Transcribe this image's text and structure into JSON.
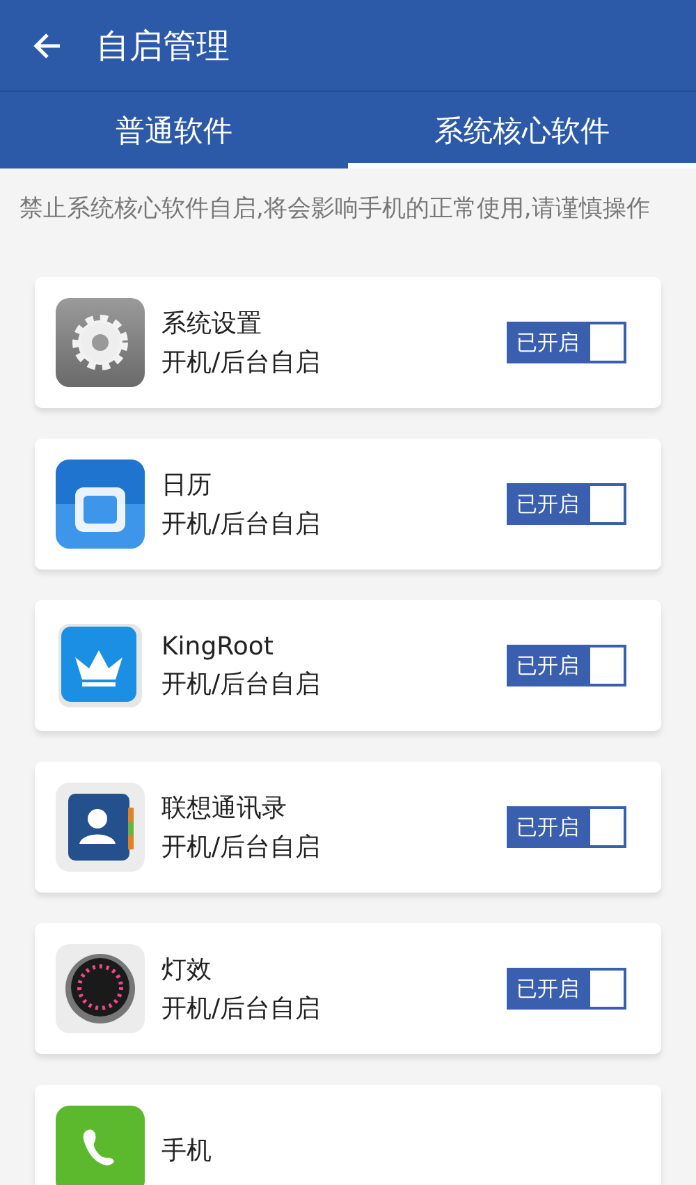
{
  "header": {
    "title": "自启管理"
  },
  "tabs": [
    {
      "label": "普通软件",
      "selected": false
    },
    {
      "label": "系统核心软件",
      "selected": true
    }
  ],
  "notice": "禁止系统核心软件自启,将会影响手机的正常使用,请谨慎操作",
  "apps": [
    {
      "kind": "settings",
      "name": "系统设置",
      "subtitle": "开机/后台自启",
      "toggle": {
        "label": "已开启",
        "on": true
      }
    },
    {
      "kind": "calendar",
      "name": "日历",
      "subtitle": "开机/后台自启",
      "toggle": {
        "label": "已开启",
        "on": true
      }
    },
    {
      "kind": "crown",
      "name": "KingRoot",
      "subtitle": "开机/后台自启",
      "toggle": {
        "label": "已开启",
        "on": true
      }
    },
    {
      "kind": "contacts",
      "name": "联想通讯录",
      "subtitle": "开机/后台自启",
      "toggle": {
        "label": "已开启",
        "on": true
      }
    },
    {
      "kind": "led",
      "name": "灯效",
      "subtitle": "开机/后台自启",
      "toggle": {
        "label": "已开启",
        "on": true
      }
    },
    {
      "kind": "phone",
      "name": "手机"
    }
  ]
}
